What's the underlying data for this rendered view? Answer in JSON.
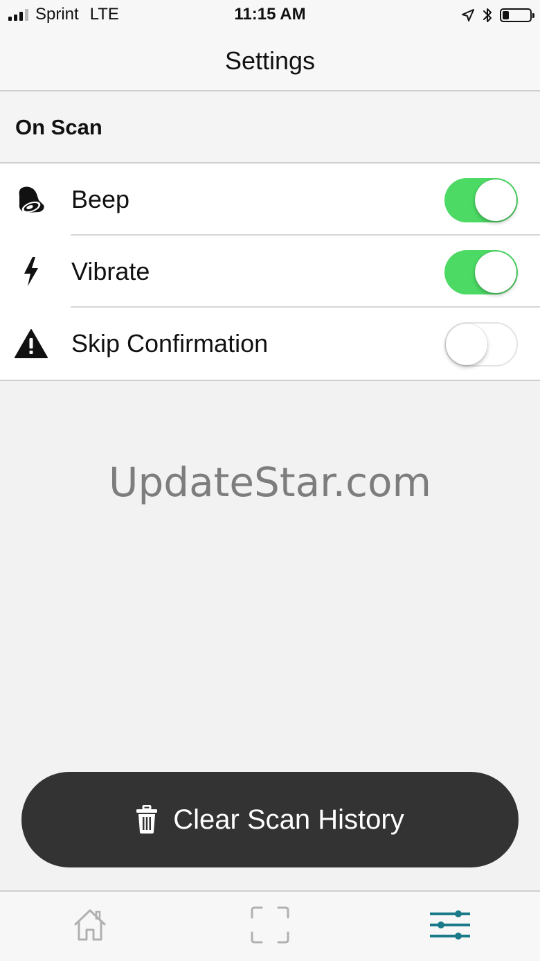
{
  "status_bar": {
    "carrier": "Sprint",
    "network": "LTE",
    "time": "11:15 AM"
  },
  "nav": {
    "title": "Settings"
  },
  "section": {
    "title": "On Scan"
  },
  "settings": [
    {
      "label": "Beep",
      "icon": "bell-icon",
      "enabled": true
    },
    {
      "label": "Vibrate",
      "icon": "lightning-icon",
      "enabled": true
    },
    {
      "label": "Skip Confirmation",
      "icon": "warning-icon",
      "enabled": false
    }
  ],
  "watermark": "UpdateStar.com",
  "clear_button": {
    "label": "Clear Scan History",
    "icon": "trash-icon"
  },
  "tabs": [
    {
      "name": "home",
      "icon": "home-icon",
      "active": false
    },
    {
      "name": "scan",
      "icon": "scan-icon",
      "active": false
    },
    {
      "name": "settings",
      "icon": "sliders-icon",
      "active": true
    }
  ],
  "colors": {
    "toggle_on": "#4cd964",
    "button_bg": "#333333",
    "active_tab": "#1a7a8a",
    "inactive_tab": "#b0b0b0"
  }
}
